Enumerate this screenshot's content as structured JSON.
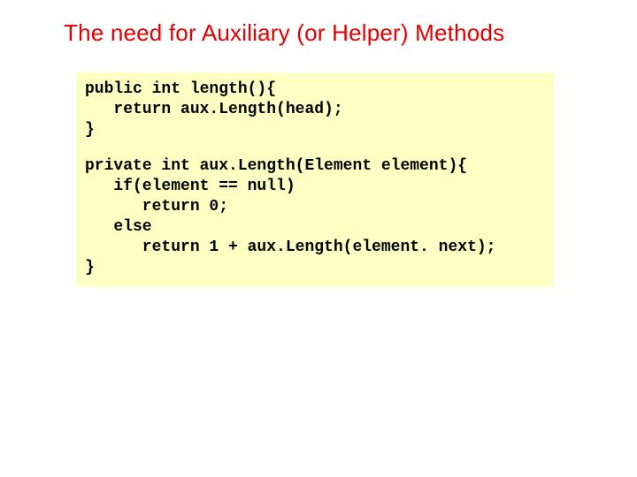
{
  "slide": {
    "title": "The need for Auxiliary (or Helper) Methods",
    "code": {
      "block1": "public int length(){\n   return aux.Length(head);\n}",
      "block2": "private int aux.Length(Element element){\n   if(element == null)\n      return 0;\n   else\n      return 1 + aux.Length(element. next);\n}"
    }
  }
}
